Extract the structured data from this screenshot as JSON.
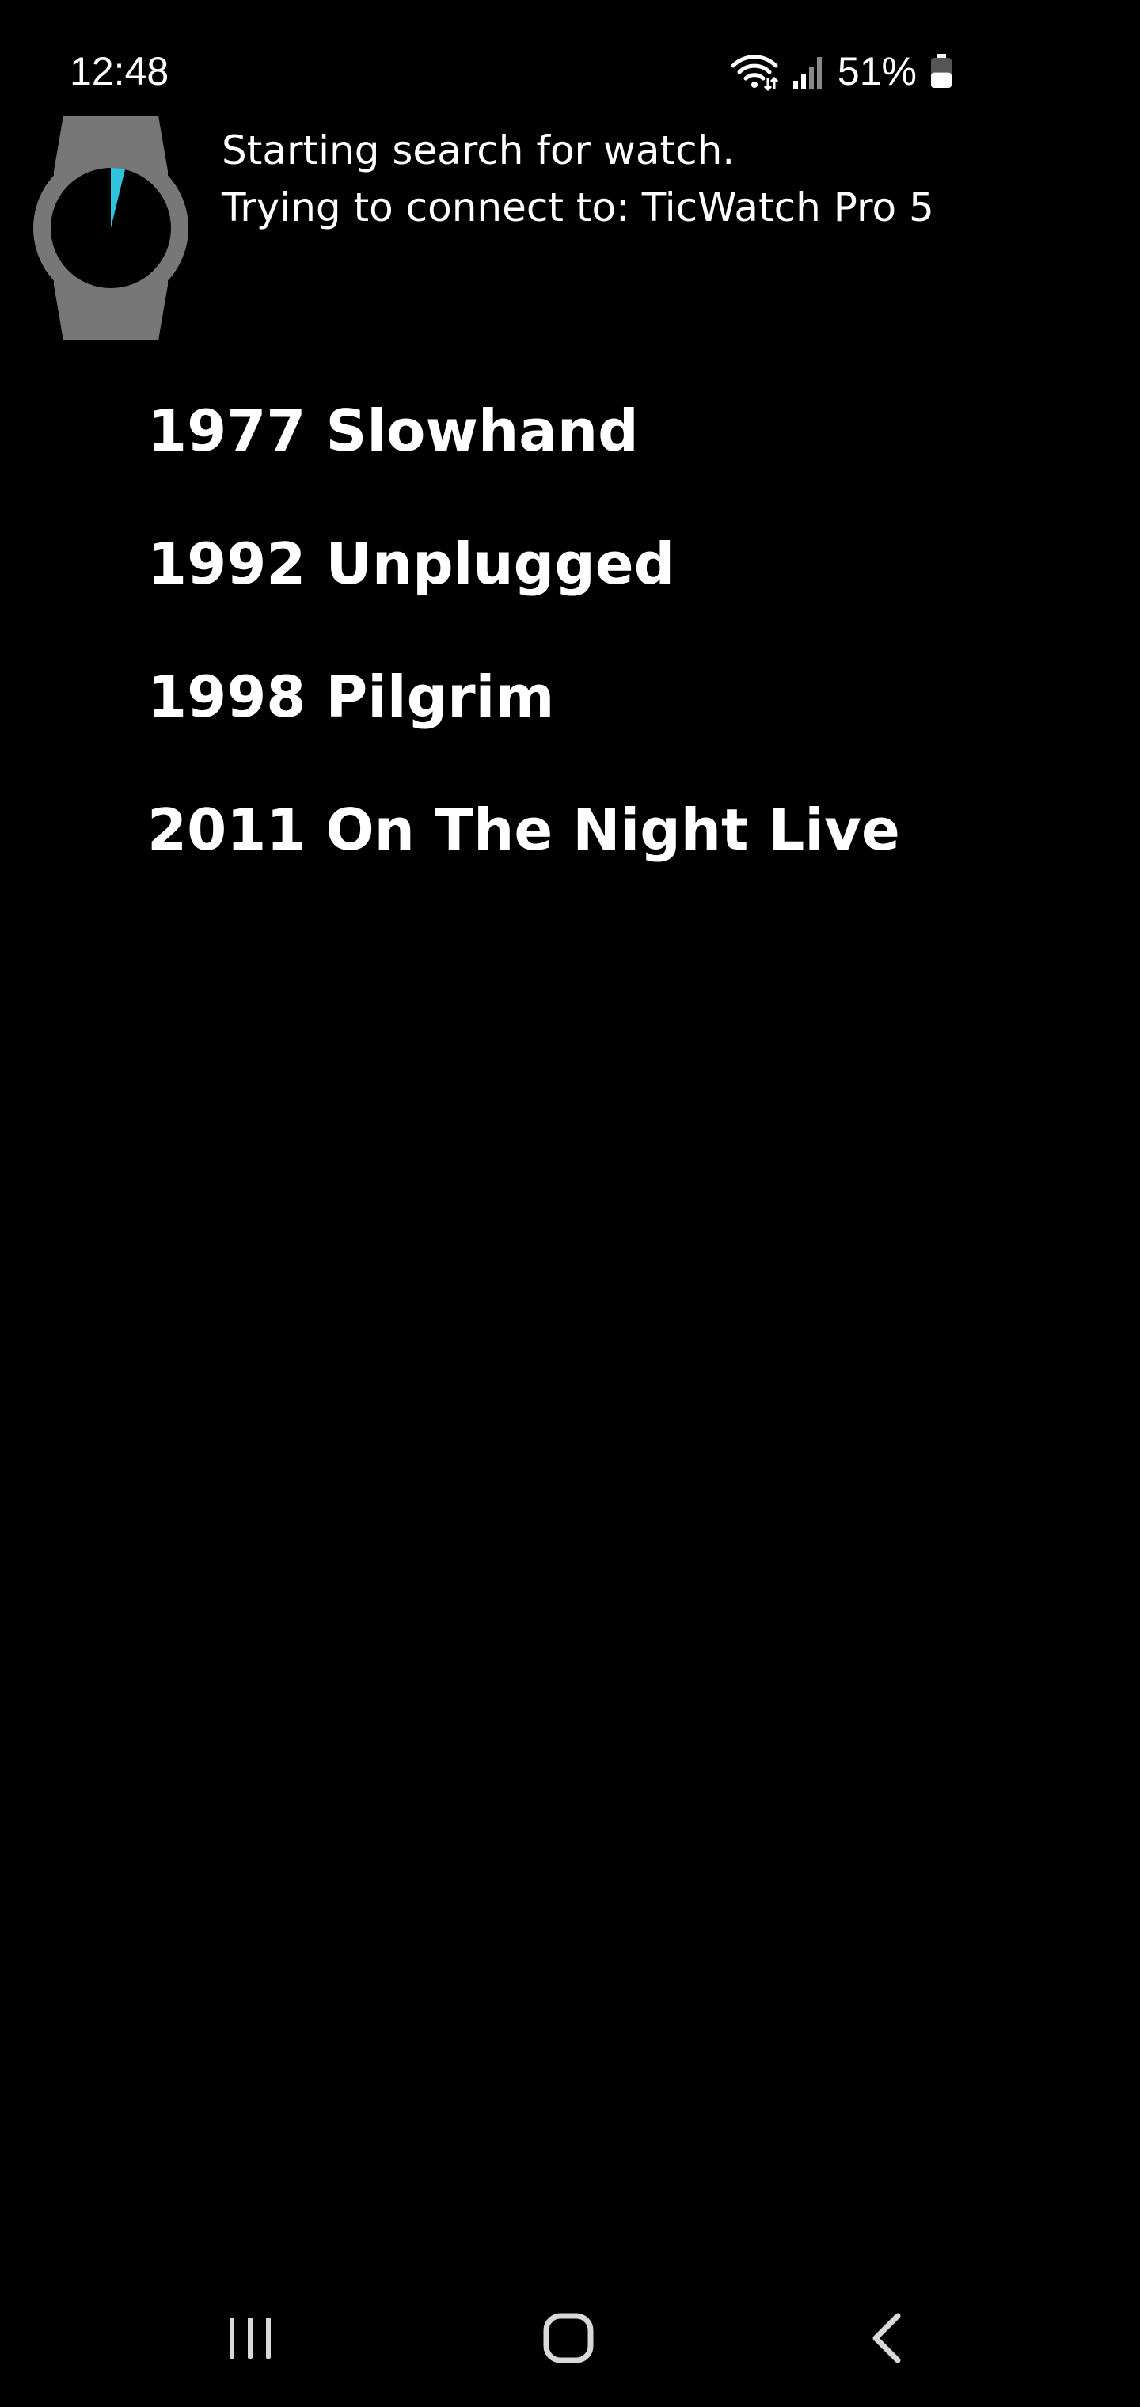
{
  "status_bar": {
    "time": "12:48",
    "battery_percent": "51%",
    "battery_level": 0.51,
    "icons": [
      "wifi-icon",
      "signal-icon",
      "battery-icon"
    ]
  },
  "header": {
    "icon": "smartwatch-search-icon",
    "line1": "Starting search for watch.",
    "line2": "Trying to connect to: TicWatch Pro 5"
  },
  "albums": [
    {
      "label": "1977 Slowhand"
    },
    {
      "label": "1992 Unplugged"
    },
    {
      "label": "1998 Pilgrim"
    },
    {
      "label": "2011 On The Night Live"
    }
  ],
  "nav_bar": {
    "icons": [
      "recents-icon",
      "home-icon",
      "back-icon"
    ]
  },
  "colors": {
    "background": "#000000",
    "text": "#ffffff",
    "watch_body": "#777777",
    "search_sweep": "#2ec4dc"
  }
}
